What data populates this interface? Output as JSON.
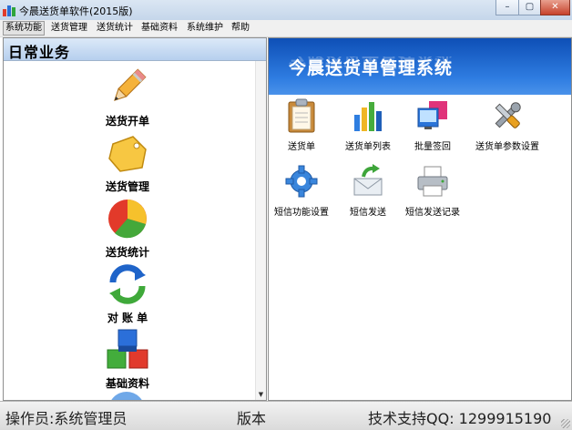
{
  "window": {
    "title": "今晨送货单软件(2015版)",
    "minimize_glyph": "–",
    "maximize_glyph": "▢",
    "close_glyph": "✕"
  },
  "menu": [
    {
      "label": "系统功能",
      "active": true
    },
    {
      "label": "送货管理"
    },
    {
      "label": "送货统计"
    },
    {
      "label": "基础资料"
    },
    {
      "label": "系统维护"
    },
    {
      "label": "帮助"
    }
  ],
  "left_panel": {
    "header": "日常业务",
    "items": [
      {
        "label": "送货开单",
        "icon": "pencil-icon"
      },
      {
        "label": "送货管理",
        "icon": "tag-icon"
      },
      {
        "label": "送货统计",
        "icon": "pie-chart-icon"
      },
      {
        "label": "对 账 单",
        "icon": "refresh-arrows-icon"
      },
      {
        "label": "基础资料",
        "icon": "blocks-icon"
      }
    ],
    "scroll_down_glyph": "▼"
  },
  "right_panel": {
    "banner_title": "今晨送货单管理系统",
    "tiles": [
      {
        "label": "送货单",
        "icon": "clipboard-icon"
      },
      {
        "label": "送货单列表",
        "icon": "bar-chart-icon"
      },
      {
        "label": "批量签回",
        "icon": "monitor-icon"
      },
      {
        "label": "送货单参数设置",
        "icon": "tools-icon"
      },
      {
        "label": "短信功能设置",
        "icon": "gear-icon"
      },
      {
        "label": "短信发送",
        "icon": "send-mail-icon"
      },
      {
        "label": "短信发送记录",
        "icon": "printer-icon"
      }
    ]
  },
  "status": {
    "operator": "操作员:系统管理员",
    "version": "版本",
    "support": "技术支持QQ: 1299915190"
  }
}
